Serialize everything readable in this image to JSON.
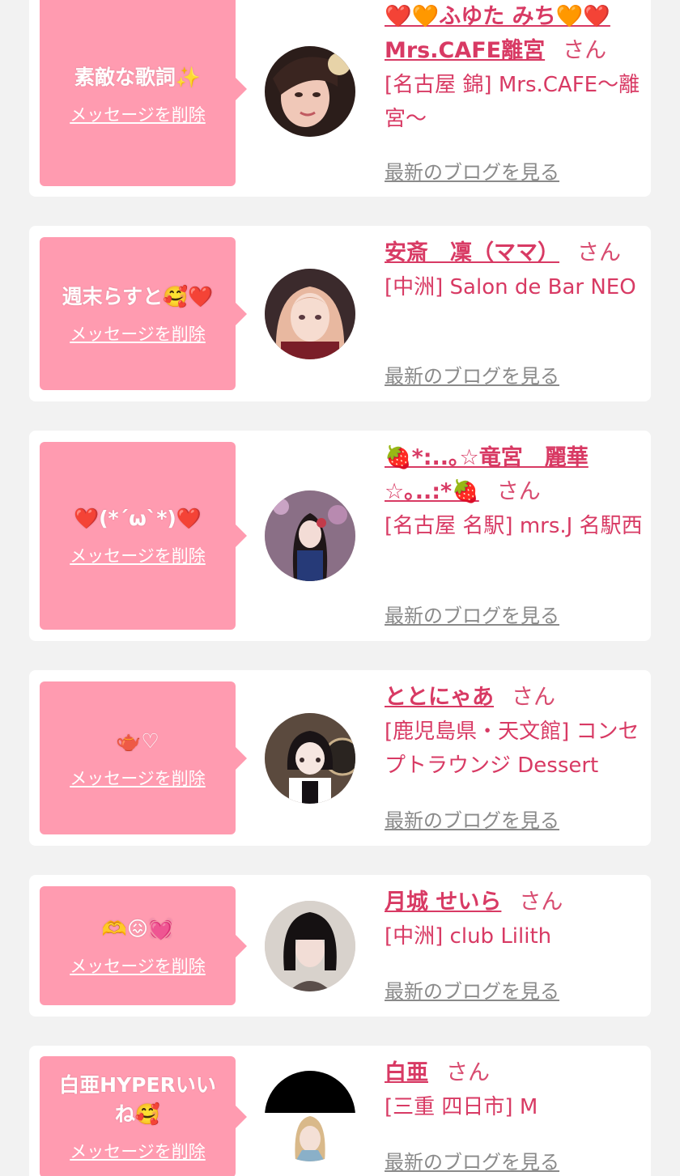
{
  "entries": [
    {
      "message": "素敵な歌詞✨",
      "delete_label": "メッセージを削除",
      "name": "❤️🧡ふゆた みち🧡❤️ Mrs.CAFE離宮",
      "honorific": "さん",
      "shop": "[名古屋 錦] Mrs.CAFE〜離宮〜",
      "blog_label": "最新のブログを見る"
    },
    {
      "message": "週末らすと🥰❤️",
      "delete_label": "メッセージを削除",
      "name": "安斎　凜（ママ）",
      "honorific": "さん",
      "shop": "[中洲] Salon de Bar NEO",
      "blog_label": "最新のブログを見る"
    },
    {
      "message": "❤️(*´ω`*)❤️",
      "delete_label": "メッセージを削除",
      "name": "🍓*:..｡☆竜宮　麗華☆｡..:*🍓",
      "honorific": "さん",
      "shop": "[名古屋 名駅] mrs.J 名駅西",
      "blog_label": "最新のブログを見る"
    },
    {
      "message": "🫖♡",
      "delete_label": "メッセージを削除",
      "name": "ととにゃあ",
      "honorific": "さん",
      "shop": "[鹿児島県・天文館] コンセプトラウンジ Dessert",
      "blog_label": "最新のブログを見る"
    },
    {
      "message": "🫶😖💓",
      "delete_label": "メッセージを削除",
      "name": "月城 せいら",
      "honorific": "さん",
      "shop": "[中洲] club Lilith",
      "blog_label": "最新のブログを見る"
    },
    {
      "message": "白亜HYPERいいね🥰",
      "delete_label": "メッセージを削除",
      "name": "白亜",
      "honorific": "さん",
      "shop": "[三重 四日市] M",
      "blog_label": "最新のブログを見る"
    }
  ],
  "colors": {
    "background": "#f2f2f2",
    "bubble": "#ff9bb0",
    "name": "#d83a64",
    "link_gray": "#8a8a8a"
  }
}
